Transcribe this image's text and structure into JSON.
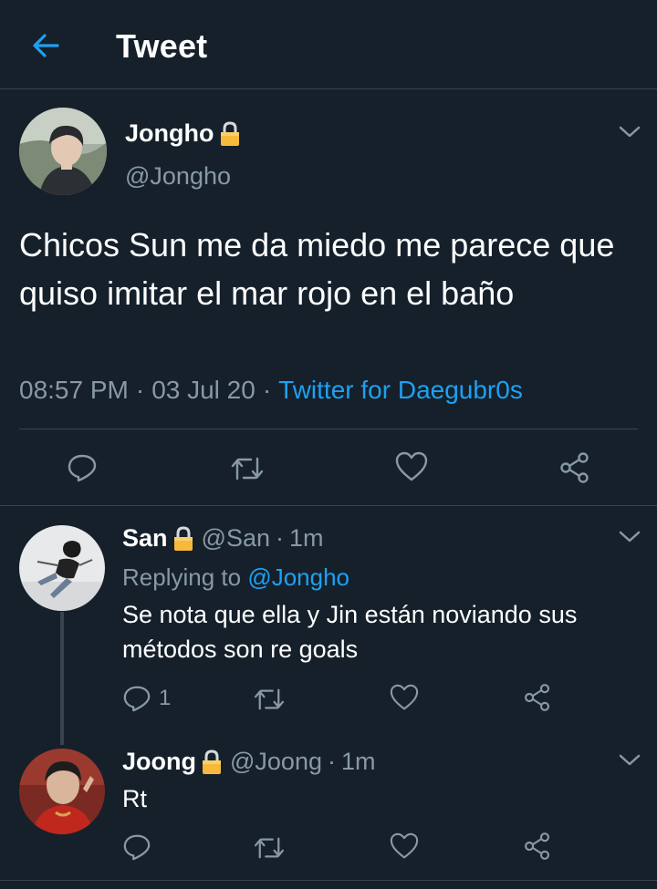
{
  "header": {
    "title": "Tweet",
    "back_icon": "arrow-left-icon"
  },
  "colors": {
    "background": "#15202b",
    "accent": "#1da1f2",
    "muted": "#8899a6",
    "divider": "#38444d"
  },
  "main_tweet": {
    "name": "Jongho",
    "handle": "@Jongho",
    "text": "Chicos Sun me da miedo me parece que quiso imitar el mar rojo en el baño",
    "time": "08:57 PM",
    "date": "03 Jul 20",
    "source": "Twitter for Daegubr0s",
    "actions": [
      "reply-icon",
      "retweet-icon",
      "like-icon",
      "share-icon"
    ]
  },
  "replies": [
    {
      "name": "San",
      "handle": "@San",
      "time": "1m",
      "replying_label": "Replying to",
      "replying_to": "@Jongho",
      "text": "Se nota que ella y Jin están noviando sus métodos son re goals",
      "reply_count": "1"
    },
    {
      "name": "Joong",
      "handle": "@Joong",
      "time": "1m",
      "text": "Rt"
    }
  ]
}
